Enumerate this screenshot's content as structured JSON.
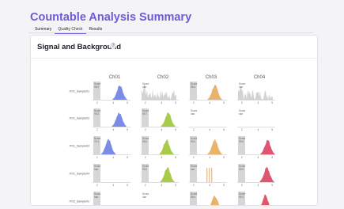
{
  "page_title": "Countable Analysis Summary",
  "tabs": [
    "Summary",
    "Quality Check",
    "Results"
  ],
  "active_tab": 1,
  "section": {
    "title": "Signal and Background",
    "help_icon": "?"
  },
  "channels": [
    {
      "name": "Ch01",
      "color": "#7a8ce6"
    },
    {
      "name": "Ch02",
      "color": "#a8cc4a"
    },
    {
      "name": "Ch03",
      "color": "#eab36c"
    },
    {
      "name": "Ch04",
      "color": "#de5670"
    }
  ],
  "samples": [
    {
      "name": "PO1_Sample01",
      "panels": [
        {
          "score": "Score\n98.9",
          "signal": true,
          "peak": 0.72,
          "bg": "normal"
        },
        {
          "score": "Score\nnan",
          "signal": false,
          "peak": 0,
          "bg": "spiky"
        },
        {
          "score": "Score\n98.4",
          "signal": true,
          "peak": 0.68,
          "bg": "normal"
        },
        {
          "score": "Score\nnan",
          "signal": false,
          "peak": 0,
          "bg": "spiky"
        }
      ]
    },
    {
      "name": "PO1_Sample02",
      "panels": [
        {
          "score": "Score\n99.3",
          "signal": true,
          "peak": 0.7,
          "bg": "normal"
        },
        {
          "score": "Score\n99.7",
          "signal": true,
          "peak": 0.72,
          "bg": "normal"
        },
        {
          "score": "Score\nnan",
          "signal": false,
          "peak": 0,
          "bg": "flat"
        },
        {
          "score": "Score\nnan",
          "signal": false,
          "peak": 0,
          "bg": "flat"
        }
      ]
    },
    {
      "name": "PO1_Sample03",
      "panels": [
        {
          "score": "Score\n70.1",
          "signal": true,
          "peak": 0.42,
          "bg": "normal"
        },
        {
          "score": "Score\n99.6",
          "signal": true,
          "peak": 0.68,
          "bg": "normal"
        },
        {
          "score": "Score\n99.4",
          "signal": true,
          "peak": 0.68,
          "bg": "normal"
        },
        {
          "score": "Score\n99.6",
          "signal": true,
          "peak": 0.8,
          "bg": "normal"
        }
      ]
    },
    {
      "name": "PO1_Sample04",
      "panels": [
        {
          "score": "Score\nnan",
          "signal": false,
          "peak": 0,
          "bg": "normal"
        },
        {
          "score": "Score\n99.0",
          "signal": true,
          "peak": 0.7,
          "bg": "normal"
        },
        {
          "score": "Score\nnan",
          "signal": false,
          "peak": 0,
          "bg": "bars"
        },
        {
          "score": "Score\n99.9",
          "signal": true,
          "peak": 0.78,
          "bg": "normal"
        }
      ]
    },
    {
      "name": "PO2_Sample01",
      "panels": [
        {
          "score": "Score\nnan",
          "signal": false,
          "peak": 0,
          "bg": "normal"
        },
        {
          "score": "Score\nnan",
          "signal": false,
          "peak": 0,
          "bg": "flat"
        },
        {
          "score": "Score\n98.4",
          "signal": true,
          "peak": 0.68,
          "bg": "normal"
        },
        {
          "score": "Score\n99.4",
          "signal": true,
          "peak": 0.74,
          "bg": "normal"
        }
      ]
    }
  ],
  "x_ticks": [
    "2",
    "4",
    "5"
  ]
}
